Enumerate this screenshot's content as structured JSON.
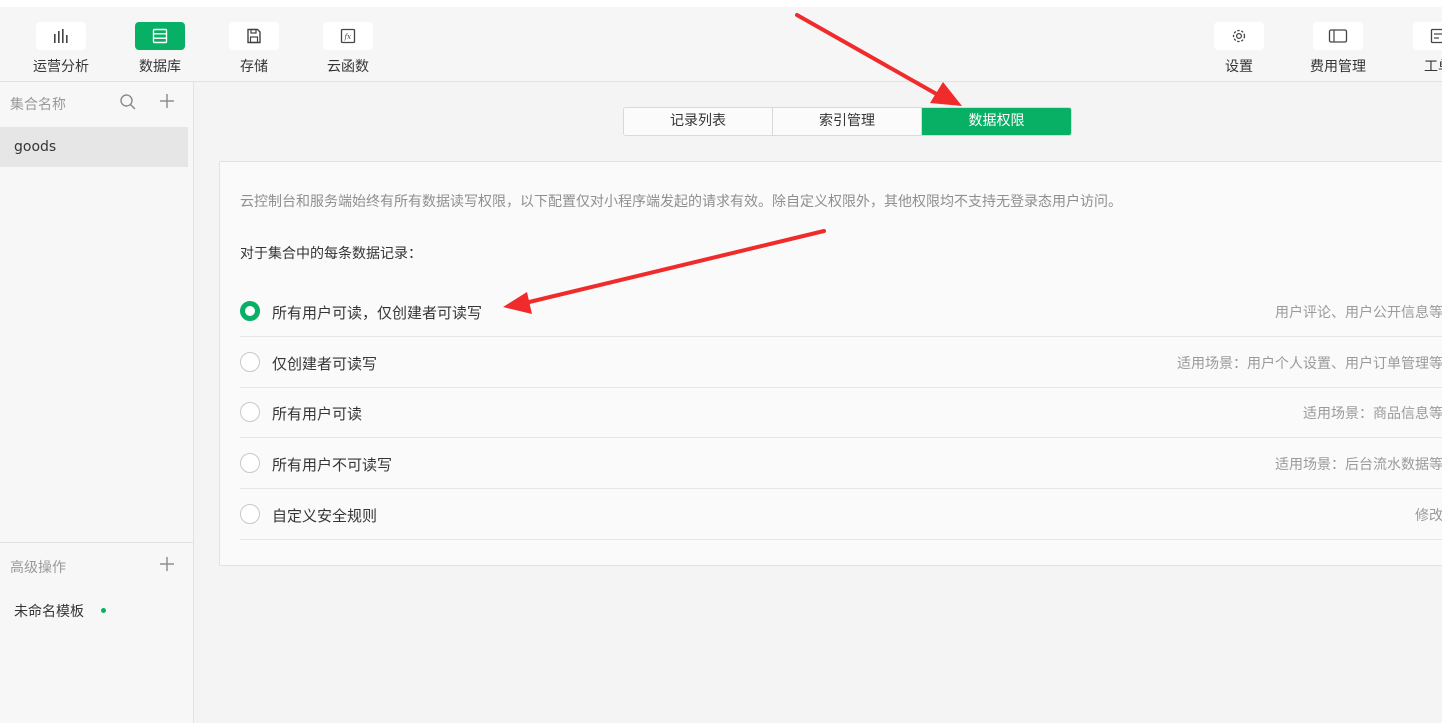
{
  "toolbar": {
    "left": [
      {
        "label": "运营分析",
        "icon": "bar-chart-icon",
        "active": false
      },
      {
        "label": "数据库",
        "icon": "database-icon",
        "active": true
      },
      {
        "label": "存储",
        "icon": "floppy-disk-icon",
        "active": false
      },
      {
        "label": "云函数",
        "icon": "function-icon",
        "active": false
      }
    ],
    "right": [
      {
        "label": "设置",
        "icon": "gear-icon"
      },
      {
        "label": "费用管理",
        "icon": "wallet-icon"
      },
      {
        "label": "工单",
        "icon": "ticket-icon"
      }
    ]
  },
  "sidebar": {
    "collections_title": "集合名称",
    "collections": [
      "goods"
    ],
    "advanced_title": "高级操作",
    "template_name": "未命名模板"
  },
  "tabs": [
    "记录列表",
    "索引管理",
    "数据权限"
  ],
  "active_tab": 2,
  "panel": {
    "description": "云控制台和服务端始终有所有数据读写权限，以下配置仅对小程序端发起的请求有效。除自定义权限外，其他权限均不支持无登录态用户访问。",
    "intro": "对于集合中的每条数据记录：",
    "options": [
      {
        "label": "所有用户可读，仅创建者可读写",
        "scene": "用户评论、用户公开信息等",
        "checked": true
      },
      {
        "label": "仅创建者可读写",
        "scene": "适用场景：用户个人设置、用户订单管理等",
        "checked": false
      },
      {
        "label": "所有用户可读",
        "scene": "适用场景：商品信息等",
        "checked": false
      },
      {
        "label": "所有用户不可读写",
        "scene": "适用场景：后台流水数据等",
        "checked": false
      },
      {
        "label": "自定义安全规则",
        "scene": "修改",
        "checked": false
      }
    ]
  },
  "colors": {
    "accent": "#07b064",
    "annotation_arrow": "#f02b2b"
  }
}
